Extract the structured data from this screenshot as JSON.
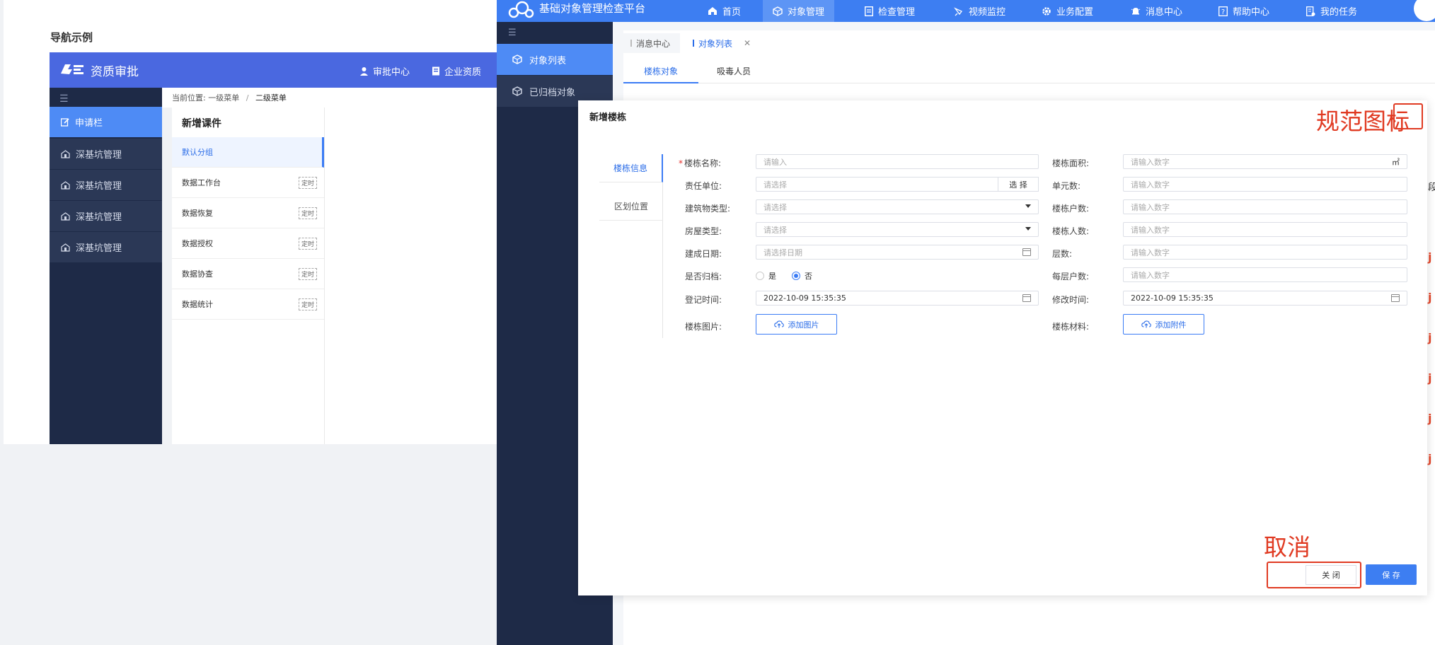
{
  "example": {
    "section_title": "导航示例",
    "app_title": "资质审批",
    "header_nav": [
      {
        "label": "审批中心",
        "icon": "user-icon"
      },
      {
        "label": "企业资质",
        "icon": "document-icon"
      }
    ],
    "sidebar": [
      {
        "label": "申请栏",
        "icon": "edit-icon",
        "active": true
      },
      {
        "label": "深基坑管理",
        "icon": "building-icon"
      },
      {
        "label": "深基坑管理",
        "icon": "building-icon"
      },
      {
        "label": "深基坑管理",
        "icon": "building-icon"
      },
      {
        "label": "深基坑管理",
        "icon": "building-icon"
      }
    ],
    "breadcrumb": {
      "prefix": "当前位置:",
      "level1": "一级菜单",
      "sep": "/",
      "level2": "二级菜单"
    },
    "panel": {
      "title": "新增课件",
      "items": [
        {
          "label": "默认分组",
          "badge": "",
          "active": true
        },
        {
          "label": "数据工作台",
          "badge": "定时"
        },
        {
          "label": "数据恢复",
          "badge": "定时"
        },
        {
          "label": "数据授权",
          "badge": "定时"
        },
        {
          "label": "数据协查",
          "badge": "定时"
        },
        {
          "label": "数据统计",
          "badge": "定时"
        }
      ]
    }
  },
  "app": {
    "title": "基础对象管理检查平台",
    "nav": [
      {
        "label": "首页",
        "icon": "home-icon"
      },
      {
        "label": "对象管理",
        "icon": "cube-icon",
        "active": true
      },
      {
        "label": "检查管理",
        "icon": "checklist-icon"
      },
      {
        "label": "视频监控",
        "icon": "camera-icon"
      },
      {
        "label": "业务配置",
        "icon": "gear-icon"
      },
      {
        "label": "消息中心",
        "icon": "bell-icon"
      },
      {
        "label": "帮助中心",
        "icon": "help-icon"
      },
      {
        "label": "我的任务",
        "icon": "task-icon"
      }
    ],
    "sidebar": [
      {
        "label": "对象列表",
        "icon": "cube-icon",
        "active": true
      },
      {
        "label": "已归档对象",
        "icon": "cube-icon"
      }
    ],
    "tabs": [
      {
        "label": "消息中心"
      },
      {
        "label": "对象列表",
        "active": true,
        "closable": true
      }
    ],
    "subtabs": [
      {
        "label": "楼栋对象",
        "active": true
      },
      {
        "label": "吸毒人员"
      }
    ]
  },
  "modal": {
    "title": "新增楼栋",
    "side_tabs": [
      {
        "label": "楼栋信息",
        "active": true
      },
      {
        "label": "区划位置"
      }
    ],
    "left_fields": {
      "name": {
        "label": "楼栋名称:",
        "placeholder": "请输入",
        "required": true
      },
      "unit": {
        "label": "责任单位:",
        "placeholder": "请选择",
        "button": "选 择"
      },
      "building_type": {
        "label": "建筑物类型:",
        "placeholder": "请选择"
      },
      "house_type": {
        "label": "房屋类型:",
        "placeholder": "请选择"
      },
      "built_date": {
        "label": "建成日期:",
        "placeholder": "请选择日期"
      },
      "archived": {
        "label": "是否归档:",
        "options": [
          "是",
          "否"
        ],
        "selected": "否"
      },
      "register_time": {
        "label": "登记时间:",
        "value": "2022-10-09 15:35:35"
      },
      "photo": {
        "label": "楼栋图片:",
        "button": "添加图片"
      }
    },
    "right_fields": {
      "area": {
        "label": "楼栋面积:",
        "placeholder": "请输入数字",
        "suffix": "㎡"
      },
      "units": {
        "label": "单元数:",
        "placeholder": "请输入数字"
      },
      "households": {
        "label": "楼栋户数:",
        "placeholder": "请输入数字"
      },
      "people": {
        "label": "楼栋人数:",
        "placeholder": "请输入数字"
      },
      "floors": {
        "label": "层数:",
        "placeholder": "请输入数字"
      },
      "per_floor": {
        "label": "每层户数:",
        "placeholder": "请输入数字"
      },
      "modify_time": {
        "label": "修改时间:",
        "value": "2022-10-09 15:35:35"
      },
      "material": {
        "label": "楼栋材料:",
        "button": "添加附件"
      }
    },
    "close_label": "关 闭",
    "save_label": "保 存"
  },
  "annotations": {
    "icon_note": "规范图标",
    "cancel_note": "取消"
  },
  "peek_glyph": "段",
  "colors": {
    "primary": "#3d7ef2",
    "sidebar": "#1e2a47",
    "accent_red": "#e03a22"
  }
}
